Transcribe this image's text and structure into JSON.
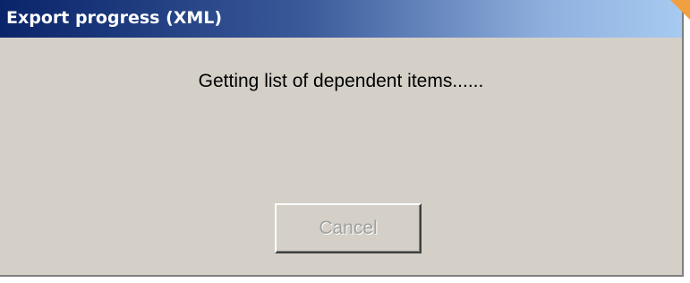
{
  "dialog": {
    "title": "Export progress (XML)",
    "status_message": "Getting list of dependent items......",
    "cancel_label": "Cancel",
    "cancel_enabled": false
  },
  "colors": {
    "titlebar_start": "#0a246a",
    "titlebar_end": "#a6caf0",
    "dialog_background": "#d4d0c8",
    "disabled_text": "#a0a0a0"
  }
}
